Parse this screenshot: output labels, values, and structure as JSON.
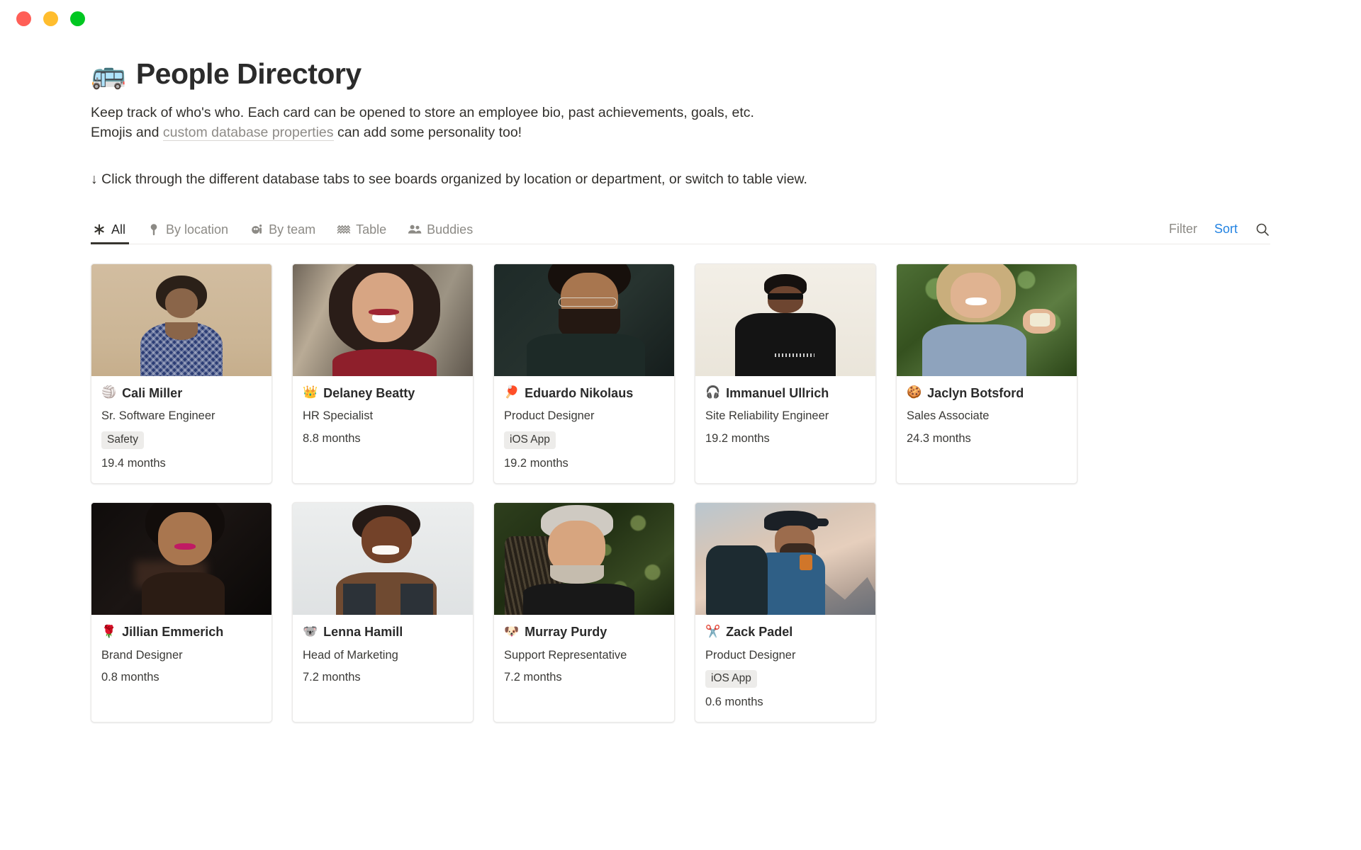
{
  "window": {
    "traffic_lights": [
      {
        "name": "close",
        "color": "#FF5F57"
      },
      {
        "name": "minimize",
        "color": "#FFBD2E"
      },
      {
        "name": "maximize",
        "color": "#00C721"
      }
    ]
  },
  "header": {
    "emoji": "🚌",
    "title": "People Directory",
    "description_line_1": "Keep track of who's who. Each card can be opened to store an employee bio, past achievements, goals, etc.",
    "description_line_2_prefix": "Emojis and ",
    "description_link": "custom database properties",
    "description_line_2_suffix": " can add some personality too!",
    "callout": "↓ Click through the different database tabs to see boards organized by location or department, or switch to table view."
  },
  "tabs": [
    {
      "label": "All",
      "icon": "asterisk-icon",
      "active": true
    },
    {
      "label": "By location",
      "icon": "map-pin-icon",
      "active": false
    },
    {
      "label": "By team",
      "icon": "person-icon",
      "active": false
    },
    {
      "label": "Table",
      "icon": "wavy-lines-icon",
      "active": false
    },
    {
      "label": "Buddies",
      "icon": "people-icon",
      "active": false
    }
  ],
  "tab_actions": {
    "filter_label": "Filter",
    "sort_label": "Sort",
    "sort_color": "#2383e2",
    "search_icon": "search-icon"
  },
  "cards": [
    {
      "emoji": "🏐",
      "name": "Cali Miller",
      "role": "Sr. Software Engineer",
      "tag": "Safety",
      "tenure": "19.4 months",
      "photo": {
        "alt": "woman in blue patterned top looking up against tan wall",
        "bg": "#cdb89a",
        "accent": "#2e3f6e"
      }
    },
    {
      "emoji": "👑",
      "name": "Delaney Beatty",
      "role": "HR Specialist",
      "tag": null,
      "tenure": "8.8 months",
      "photo": {
        "alt": "laughing woman with dark hair in red top",
        "bg": "#8d8476",
        "accent": "#8e1f2b"
      }
    },
    {
      "emoji": "🏓",
      "name": "Eduardo Nikolaus",
      "role": "Product Designer",
      "tag": "iOS App",
      "tenure": "19.2 months",
      "photo": {
        "alt": "bearded man with glasses looking down, dark background",
        "bg": "#243230",
        "accent": "#0f1a19"
      }
    },
    {
      "emoji": "🎧",
      "name": "Immanuel Ullrich",
      "role": "Site Reliability Engineer",
      "tag": null,
      "tenure": "19.2 months",
      "photo": {
        "alt": "man in black sweatshirt and sunglasses on cream background",
        "bg": "#efece4",
        "accent": "#141414"
      }
    },
    {
      "emoji": "🍪",
      "name": "Jaclyn Botsford",
      "role": "Sales Associate",
      "tag": null,
      "tenure": "24.3 months",
      "photo": {
        "alt": "laughing blonde woman outdoors with green foliage",
        "bg": "#3f5d2c",
        "accent": "#8fa8c4"
      }
    },
    {
      "emoji": "🌹",
      "name": "Jillian Emmerich",
      "role": "Brand Designer",
      "tag": null,
      "tenure": "0.8 months",
      "photo": {
        "alt": "woman with short dark hair and pink lipstick on dark background",
        "bg": "#14100f",
        "accent": "#b8704f"
      }
    },
    {
      "emoji": "🐨",
      "name": "Lenna Hamill",
      "role": "Head of Marketing",
      "tag": null,
      "tenure": "7.2 months",
      "photo": {
        "alt": "smiling woman in dark tank top on light grey background",
        "bg": "#e4e6e6",
        "accent": "#4a3a30"
      }
    },
    {
      "emoji": "🐶",
      "name": "Murray Purdy",
      "role": "Support Representative",
      "tag": null,
      "tenure": "7.2 months",
      "photo": {
        "alt": "grey haired man reclining in chair with green hedge behind",
        "bg": "#2b3a1c",
        "accent": "#c9c5bd"
      }
    },
    {
      "emoji": "✂️",
      "name": "Zack Padel",
      "role": "Product Designer",
      "tag": "iOS App",
      "tenure": "0.6 months",
      "photo": {
        "alt": "hiker with backpack against sunset mountain sky",
        "bg": "#d9c3b6",
        "accent": "#2f5f86"
      }
    }
  ]
}
